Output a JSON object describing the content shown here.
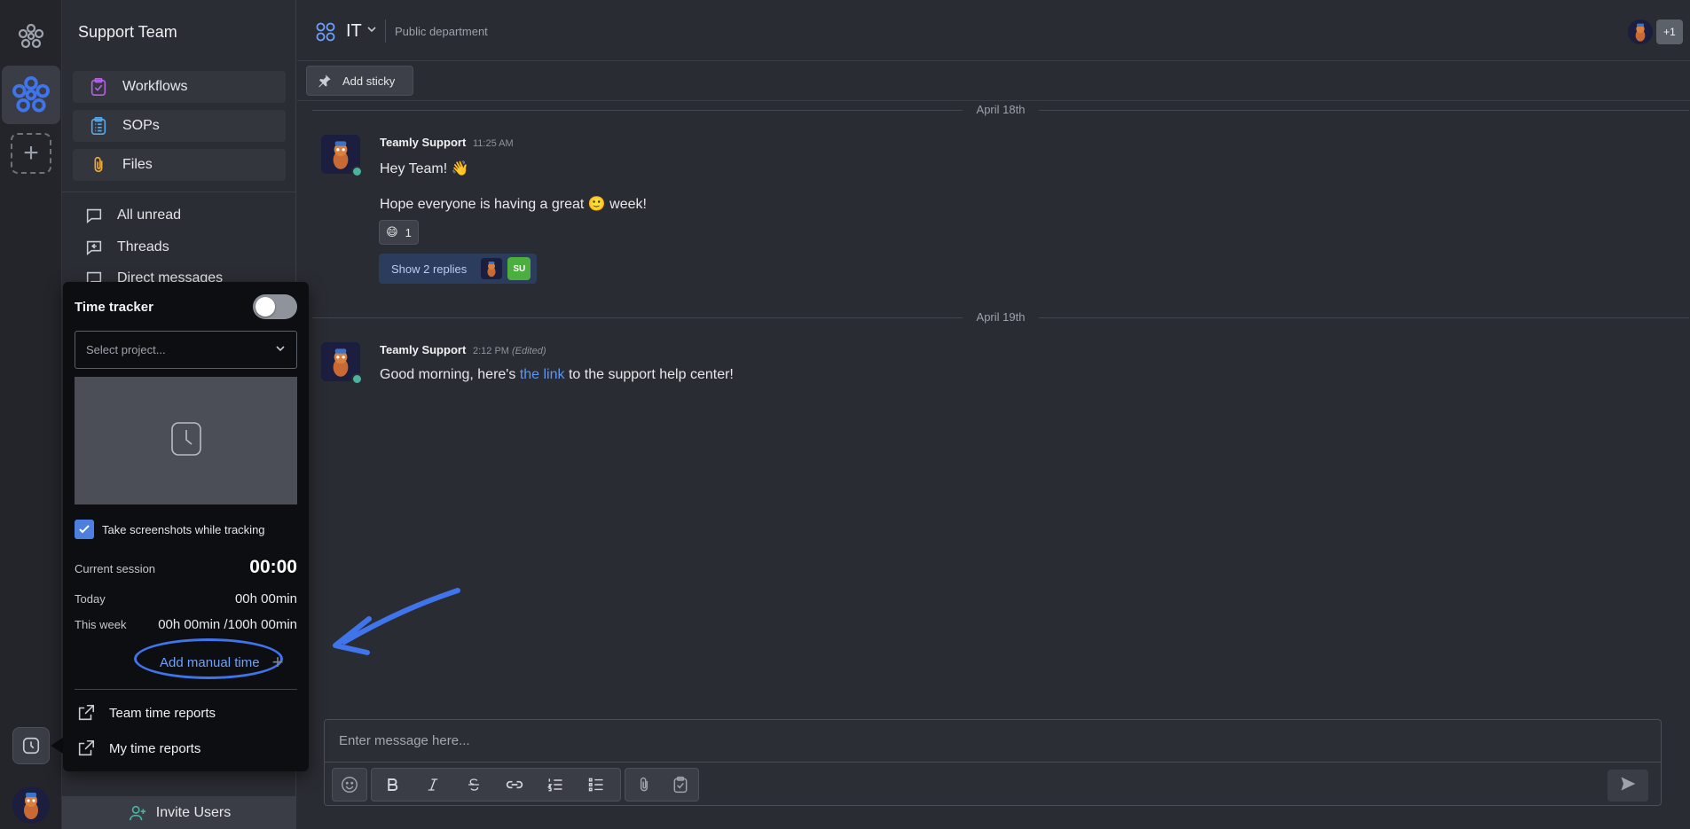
{
  "sidebar": {
    "team_name": "Support Team",
    "top_items": [
      {
        "label": "Workflows",
        "icon": "clipboard-check-icon",
        "color": "#b362e0"
      },
      {
        "label": "SOPs",
        "icon": "list-clipboard-icon",
        "color": "#5aa9e6"
      },
      {
        "label": "Files",
        "icon": "paperclip-icon",
        "color": "#e6a93c"
      }
    ],
    "items": [
      {
        "label": "All unread",
        "icon": "chat-bubble-icon"
      },
      {
        "label": "Threads",
        "icon": "threads-icon"
      },
      {
        "label": "Direct messages",
        "icon": "direct-message-icon"
      }
    ],
    "invite_label": "Invite Users"
  },
  "time_tracker": {
    "title": "Time tracker",
    "enabled": false,
    "project_placeholder": "Select project...",
    "screenshot_label": "Take screenshots while tracking",
    "screenshot_checked": true,
    "current_session_label": "Current session",
    "current_session_value": "00:00",
    "today_label": "Today",
    "today_value": "00h 00min",
    "week_label": "This week",
    "week_value": "00h 00min /100h 00min",
    "manual_time_label": "Add manual time",
    "team_reports_label": "Team time reports",
    "my_reports_label": "My time reports"
  },
  "header": {
    "channel_name": "IT",
    "channel_description": "Public department",
    "member_overflow": "+1"
  },
  "toolbar": {
    "add_sticky_label": "Add sticky"
  },
  "messages": {
    "groups": [
      {
        "date": "April 18th",
        "author": "Teamly Support",
        "time": "11:25 AM",
        "line1": "Hey Team! 👋",
        "line2": "Hope everyone is having a great 🙂 week!",
        "reaction_emoji": "😄",
        "reaction_count": "1",
        "replies_label": "Show 2 replies",
        "replier_initials": "SU"
      },
      {
        "date": "April 19th",
        "author": "Teamly Support",
        "time": "2:12 PM",
        "edited": "(Edited)",
        "text_before": "Good morning, here's ",
        "link_text": "the link",
        "text_after": " to the support help center!"
      }
    ]
  },
  "composer": {
    "placeholder": "Enter message here..."
  },
  "colors": {
    "accent": "#3f74ea",
    "link": "#5c95f0",
    "online": "#4ab3a0"
  }
}
